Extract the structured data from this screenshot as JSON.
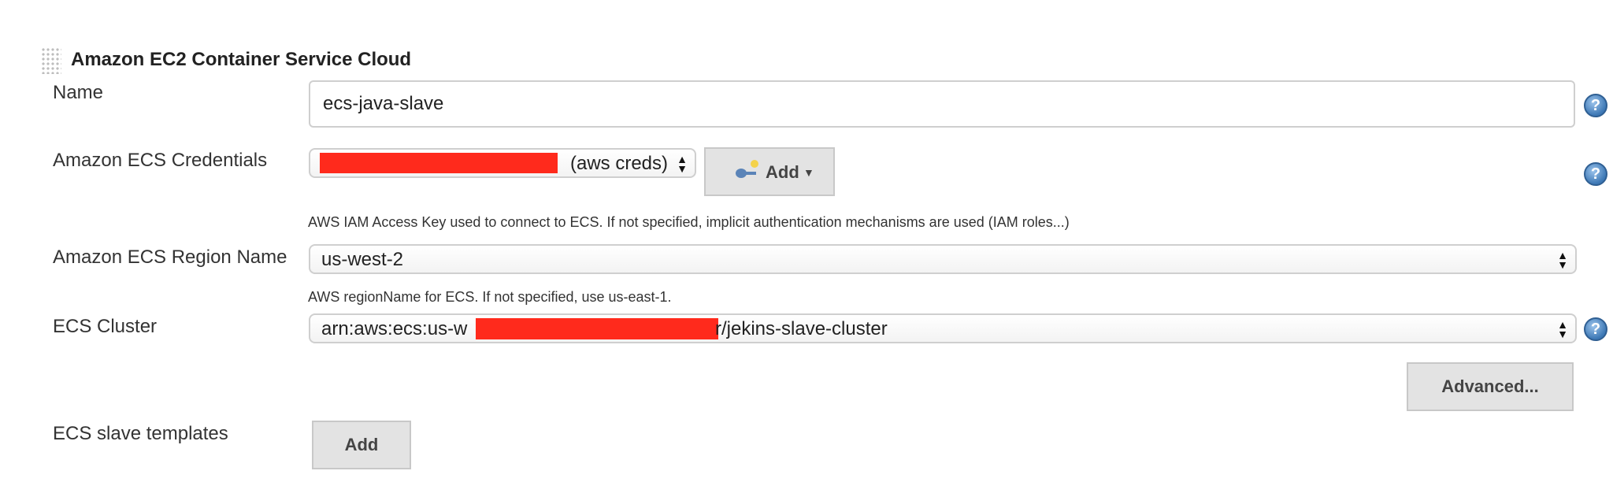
{
  "section": {
    "title": "Amazon EC2 Container Service Cloud"
  },
  "name_field": {
    "label": "Name",
    "value": "ecs-java-slave"
  },
  "credentials": {
    "label": "Amazon ECS Credentials",
    "selected_suffix": "(aws creds)",
    "add_button": "Add",
    "description": "AWS IAM Access Key used to connect to ECS. If not specified, implicit authentication mechanisms are used (IAM roles...)"
  },
  "region": {
    "label": "Amazon ECS Region Name",
    "selected": "us-west-2",
    "description": "AWS regionName for ECS. If not specified, use us-east-1."
  },
  "cluster": {
    "label": "ECS Cluster",
    "selected_prefix": "arn:aws:ecs:us-w",
    "selected_suffix": "r/jekins-slave-cluster"
  },
  "advanced_button": "Advanced...",
  "templates": {
    "label": "ECS slave templates",
    "add_button": "Add"
  },
  "icons": {
    "help": "help-icon",
    "key": "key-icon",
    "grip": "drag-handle-icon",
    "updown": "updown-arrows-icon",
    "caret": "caret-down-icon"
  },
  "colors": {
    "redaction": "#ff2a1c",
    "help_blue": "#3d78b5"
  }
}
